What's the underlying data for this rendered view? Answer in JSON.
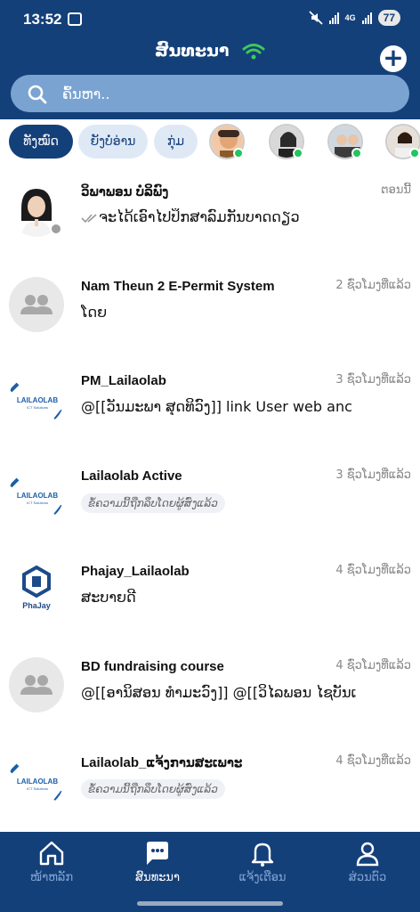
{
  "status_bar": {
    "time": "13:52",
    "network": "4G",
    "battery": "77"
  },
  "header": {
    "title": "ສົນທະນາ"
  },
  "search": {
    "placeholder": "ຄົ້ນຫາ.."
  },
  "filters": {
    "all": "ທັງໝົດ",
    "unread": "ຍັງບໍ່ອ່ານ",
    "groups": "ກຸ່ມ"
  },
  "chats": [
    {
      "name": "ວິພາພອນ ບໍລິພົງ",
      "time": "ຕອນນີ້",
      "message": "ຈະໄດ້ເອົາໄປປຶກສາລົມກັນບາດດຽວ",
      "avatar": "photo"
    },
    {
      "name": "Nam Theun 2 E-Permit System",
      "time": "2 ຊົ່ວໂມງທີ່ແລ້ວ",
      "message": "ໂດຍ",
      "avatar": "group-icon"
    },
    {
      "name": "PM_Lailaolab",
      "time": "3 ຊົ່ວໂມງທີ່ແລ້ວ",
      "message": "@[[ວັນມະພາ ສຸດທິວົງ]]  link User web anc",
      "avatar": "lailaolab-logo"
    },
    {
      "name": "Lailaolab Active",
      "time": "3 ຊົ່ວໂມງທີ່ແລ້ວ",
      "message": "ຂໍ້ຄວາມນີ້ຖືກລຶບໂດຍຜູ້ສົ່ງແລ້ວ",
      "avatar": "lailaolab-logo"
    },
    {
      "name": "Phajay_Lailaolab",
      "time": "4 ຊົ່ວໂມງທີ່ແລ້ວ",
      "message": "ສະບາຍດີ",
      "avatar": "phajay-logo"
    },
    {
      "name": "BD fundraising course",
      "time": "4 ຊົ່ວໂມງທີ່ແລ້ວ",
      "message": "@[[ອານິສອນ  ທຳມະວົງ]] @[[ວິໄລພອນ  ໄຊບັນເ",
      "avatar": "group-icon"
    },
    {
      "name": "Lailaolab_ແຈ້ງການສະເພາະ",
      "time": "4 ຊົ່ວໂມງທີ່ແລ້ວ",
      "message": "ຂໍ້ຄວາມນີ້ຖືກລຶບໂດຍຜູ້ສົ່ງແລ້ວ",
      "avatar": "lailaolab-logo"
    }
  ],
  "logos": {
    "lailaolab": "LAILAOLAB",
    "lailaolab_sub": "ICT Solutions",
    "phajay": "PhaJay"
  },
  "nav": {
    "home": "ໜ້າຫລັກ",
    "chat": "ສົນທະນາ",
    "notify": "ແຈ້ງເຕືອນ",
    "profile": "ສ່ວນຕົວ"
  },
  "colors": {
    "primary": "#14407a",
    "search_bg": "#7aa3d2",
    "online": "#22c55e",
    "chip_bg": "#dfe9f6"
  }
}
